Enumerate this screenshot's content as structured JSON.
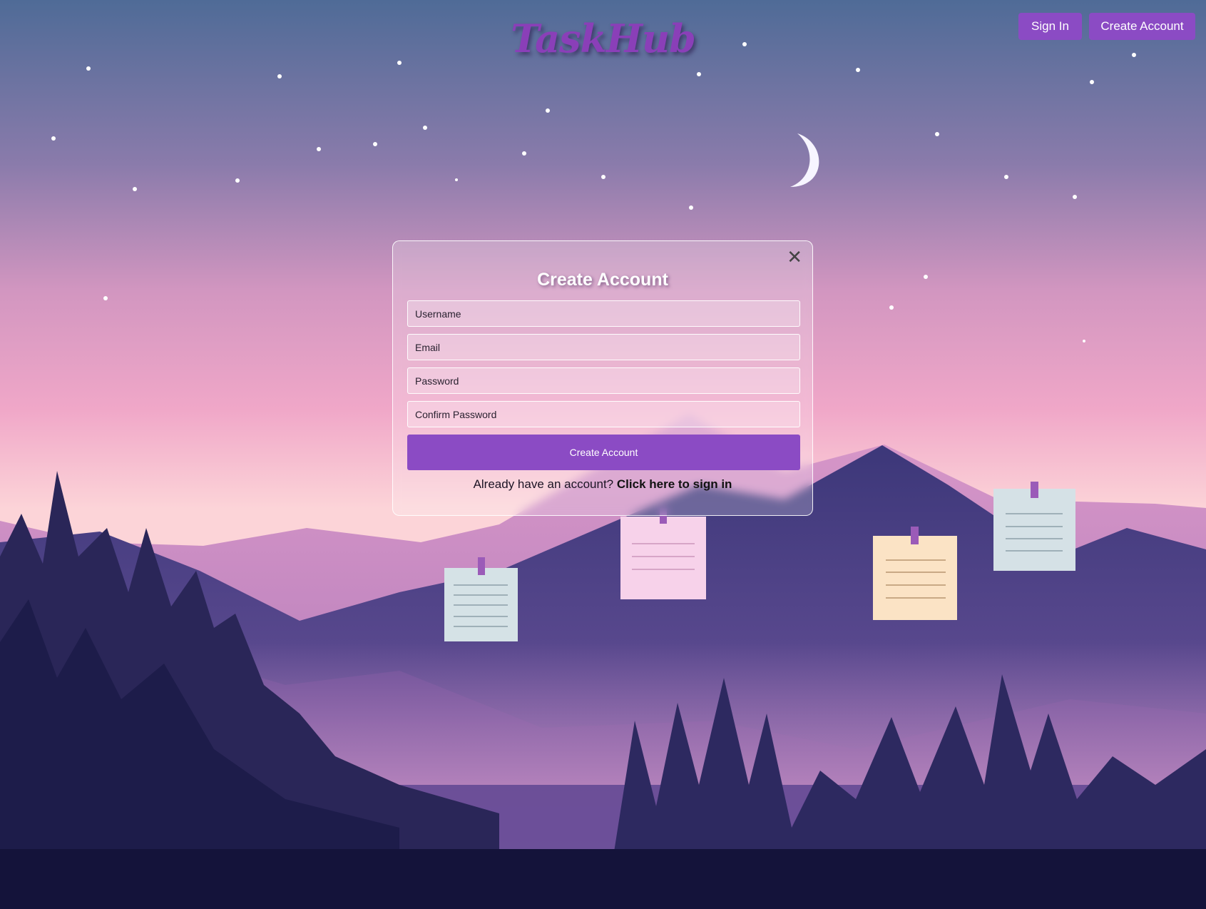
{
  "header": {
    "logo_text": "TaskHub",
    "sign_in_label": "Sign In",
    "create_account_label": "Create Account"
  },
  "modal": {
    "title": "Create Account",
    "close_glyph": "✕",
    "fields": {
      "username_placeholder": "Username",
      "email_placeholder": "Email",
      "password_placeholder": "Password",
      "confirm_password_placeholder": "Confirm Password"
    },
    "submit_label": "Create Account",
    "signin_prompt": "Already have an account?",
    "signin_link": "Click here to sign in"
  },
  "colors": {
    "accent": "#8b4bc4",
    "logo": "#8a3fb8",
    "sky_top": "#4f6b97",
    "sky_mid": "#e49bc5",
    "ground": "#14133a"
  },
  "icons": [
    "close-icon",
    "moon-icon",
    "sticky-note-icon"
  ]
}
